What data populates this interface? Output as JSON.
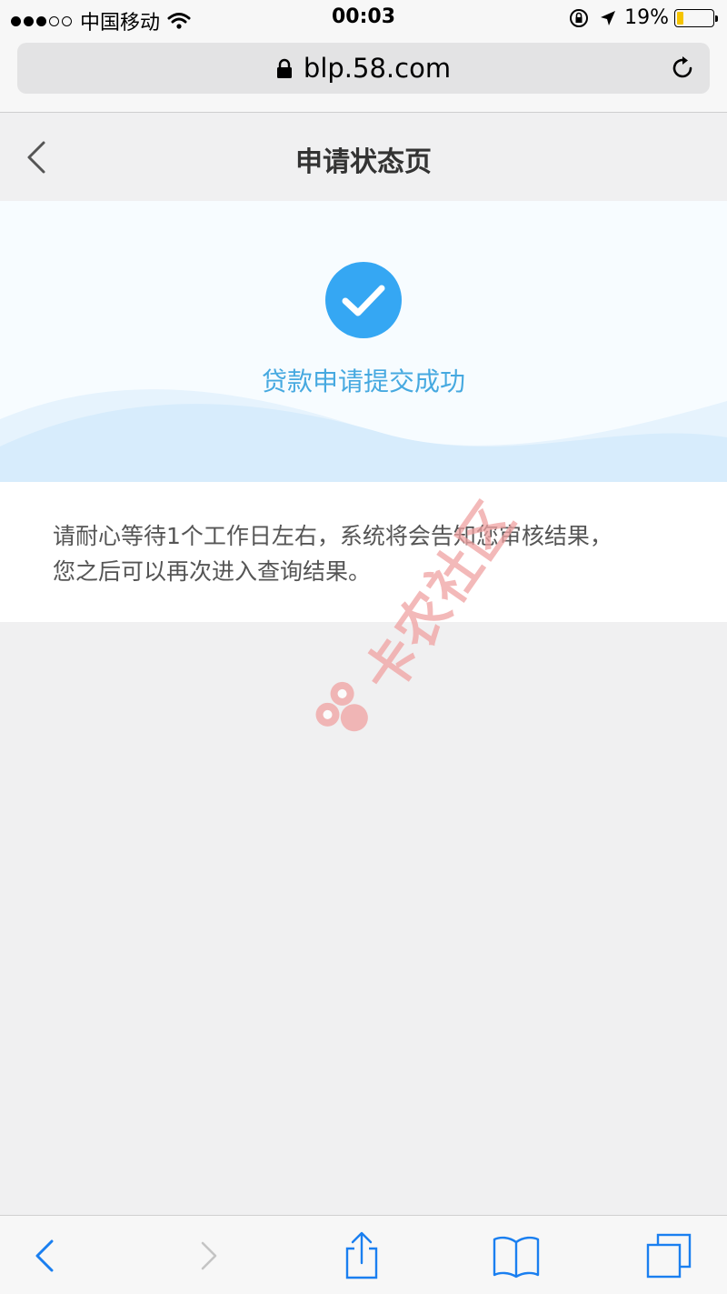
{
  "status_bar": {
    "carrier": "中国移动",
    "time": "00:03",
    "battery": "19%",
    "battery_level": 0.19,
    "icons": [
      "signal-dots",
      "wifi-icon",
      "rotation-lock-icon",
      "location-arrow-icon",
      "battery-icon"
    ]
  },
  "browser": {
    "url": "blp.58.com",
    "icons": [
      "lock-icon",
      "reload-icon"
    ]
  },
  "page": {
    "title": "申请状态页",
    "back_icon": "chevron-left-icon"
  },
  "result": {
    "icon": "checkmark-icon",
    "message": "贷款申请提交成功",
    "accent_color": "#35a7f3",
    "text_color": "#46a9e0"
  },
  "info": {
    "line1": "请耐心等待1个工作日左右，系统将会告知您审核结果，",
    "line2": "您之后可以再次进入查询结果。"
  },
  "watermark": {
    "text": "卡农社区"
  },
  "toolbar": {
    "items": [
      "back-icon",
      "forward-icon",
      "share-icon",
      "bookmarks-icon",
      "tabs-icon"
    ],
    "accent_color": "#1a7ff0"
  }
}
